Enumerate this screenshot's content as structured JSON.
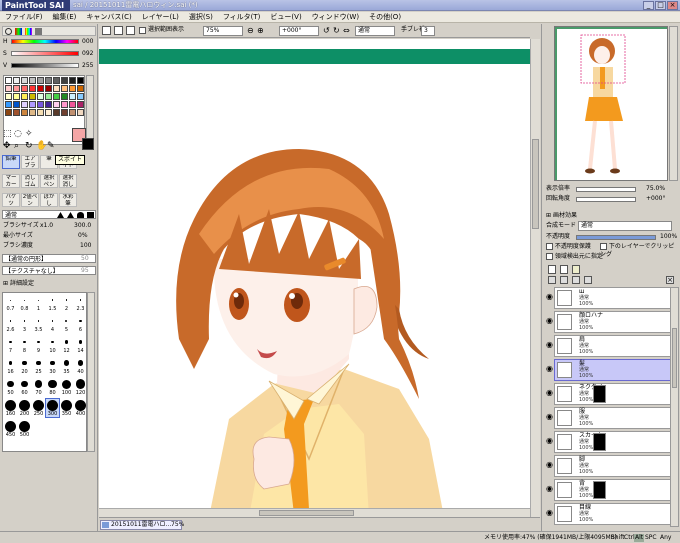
{
  "window": {
    "logo": "PaintTool SAI",
    "title": "sai / 20151011雷電ハロウィン.sai (*)",
    "minimize": "_",
    "maximize": "□",
    "close": "×"
  },
  "menu": [
    "ファイル(F)",
    "編集(E)",
    "キャンバス(C)",
    "レイヤー(L)",
    "選択(S)",
    "フィルタ(T)",
    "ビュー(V)",
    "ウィンドウ(W)",
    "その他(O)"
  ],
  "toolbar": {
    "antialias_label": "選択範囲表示",
    "zoom": "75%",
    "angle": "+000°",
    "blend": "通常",
    "stabilizer_label": "手ブレ補正",
    "stabilizer": "3"
  },
  "color": {
    "h_label": "H",
    "h_value": "000",
    "s_label": "S",
    "s_value": "092",
    "v_label": "V",
    "v_value": "255",
    "primary": "#f4a6a6",
    "secondary": "#000000"
  },
  "palette": [
    "#ffffff",
    "#f0f0f0",
    "#d8d8d8",
    "#c0c0c0",
    "#a0a0a0",
    "#808080",
    "#606060",
    "#404040",
    "#202020",
    "#000000",
    "#ffcccc",
    "#ff9999",
    "#ff6666",
    "#ff3333",
    "#cc0000",
    "#990000",
    "#ffe0c0",
    "#ffc080",
    "#ff9933",
    "#cc6600",
    "#ffffcc",
    "#ffff99",
    "#ffee55",
    "#ccbb00",
    "#e0ffe0",
    "#99ee99",
    "#44cc44",
    "#228822",
    "#ccf0ff",
    "#88ccff",
    "#3399ff",
    "#0055cc",
    "#e0d0ff",
    "#b099ff",
    "#7755dd",
    "#442299",
    "#ffd0ee",
    "#ff99cc",
    "#ee5599",
    "#aa2266",
    "#8b4513",
    "#a0522d",
    "#cd853f",
    "#deb887",
    "#f5deb3",
    "#ffefd5",
    "#5a3a2a",
    "#704030",
    "#c09070",
    "#f0d8c0"
  ],
  "tools": [
    "鉛筆",
    "エアブラシ",
    "筆",
    "スポイト",
    "マーカー",
    "消しゴム",
    "選択ペン",
    "選択消し",
    "バケツ",
    "2値ペン",
    "ぼかし",
    "水彩筆"
  ],
  "tooltip": "スポイト",
  "brush": {
    "mode": "通常",
    "size_label": "ブラシサイズ",
    "size_mult": "x1.0",
    "size_value": "300.0",
    "min_label": "最小サイズ",
    "min_value": "0%",
    "density_label": "ブラシ濃度",
    "density_value": "100",
    "shape": "【通常の円形】",
    "shape_val": "50",
    "texture": "【テクスチャなし】",
    "texture_val": "95",
    "detail": "詳細設定"
  },
  "brush_sizes": [
    "0.7",
    "0.8",
    "1",
    "1.5",
    "2",
    "2.3",
    "2.6",
    "3",
    "3.5",
    "4",
    "5",
    "6",
    "7",
    "8",
    "9",
    "10",
    "12",
    "14",
    "16",
    "20",
    "25",
    "30",
    "35",
    "40",
    "50",
    "60",
    "70",
    "80",
    "100",
    "120",
    "160",
    "200",
    "250",
    "300",
    "350",
    "400",
    "450",
    "500"
  ],
  "navigator": {
    "zoom_label": "表示倍率",
    "zoom": "75.0%",
    "angle_label": "回転角度",
    "angle": "+000°"
  },
  "layerpanel": {
    "effect_label": "画材効果",
    "blend_label": "合成モード",
    "blend": "通常",
    "opacity_label": "不透明度",
    "opacity": "100%",
    "protect_label": "不透明度保護",
    "clip_label": "下のレイヤーでクリッピング",
    "source_label": "領域検出元に指定"
  },
  "layers": [
    {
      "name": "ш",
      "mode": "通常",
      "opacity": "100%",
      "sel": false
    },
    {
      "name": "顔ロハナ",
      "mode": "通常",
      "opacity": "100%",
      "sel": false
    },
    {
      "name": "肩",
      "mode": "通常",
      "opacity": "100%",
      "sel": false
    },
    {
      "name": "髪",
      "mode": "通常",
      "opacity": "100%",
      "sel": true
    },
    {
      "name": "ネクタイ",
      "mode": "通常",
      "opacity": "100%",
      "sel": false
    },
    {
      "name": "服",
      "mode": "通常",
      "opacity": "100%",
      "sel": false
    },
    {
      "name": "スカート",
      "mode": "通常",
      "opacity": "100%",
      "sel": false
    },
    {
      "name": "脚",
      "mode": "通常",
      "opacity": "100%",
      "sel": false
    },
    {
      "name": "背",
      "mode": "通常",
      "opacity": "100%",
      "sel": false
    },
    {
      "name": "目線",
      "mode": "通常",
      "opacity": "100%",
      "sel": false
    }
  ],
  "doc_tab": {
    "name": "20151011雷電ハロ...",
    "zoom": "75%"
  },
  "status": {
    "memory": "メモリ使用率:47% (確保1941MB/上限4095MB)",
    "keys": [
      "Shift",
      "Ctrl",
      "Alt",
      "SPC",
      "Any"
    ]
  }
}
